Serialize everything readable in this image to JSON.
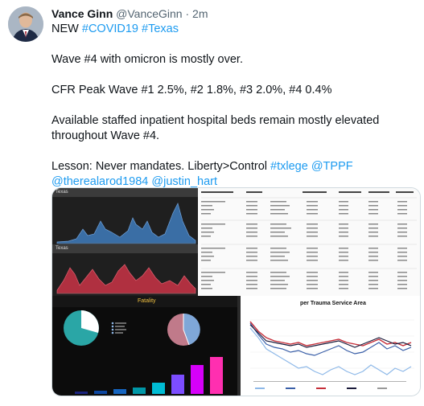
{
  "author": {
    "name": "Vance Ginn",
    "handle": "@VanceGinn",
    "separator": "·",
    "time": "2m"
  },
  "tweet": {
    "line1_prefix": "NEW",
    "hashtag1": "#COVID19",
    "hashtag2": "#Texas",
    "line2": "Wave #4 with omicron is mostly over.",
    "line3": "CFR Peak Wave #1 2.5%, #2 1.8%, #3 2.0%, #4 0.4%",
    "line4": "Available staffed inpatient hospital beds remain mostly elevated throughout Wave #4.",
    "line5_prefix": "Lesson: Never mandates. Liberty>Control",
    "hashtag3": "#txlege",
    "mention1": "@TPPF",
    "mention2": "@therealarod1984",
    "mention3": "@justin_hart"
  },
  "media": {
    "panel_top_label": "Texas",
    "panel_mid_label": "Texas",
    "panel_fatality_title": "Fatality",
    "panel_trauma_title": "per Trauma Service Area",
    "colors": {
      "area_blue": "#3a6ea5",
      "area_red": "#b03040",
      "pie_teal": "#2aa6a6",
      "pie_blue": "#7fa7d8",
      "pie_pink": "#c07a8a",
      "bar_gradient": [
        "#1a237e",
        "#1565c0",
        "#00acc1",
        "#00bcd4",
        "#7c4dff",
        "#d500f9",
        "#e040fb",
        "#ff1493"
      ]
    }
  }
}
